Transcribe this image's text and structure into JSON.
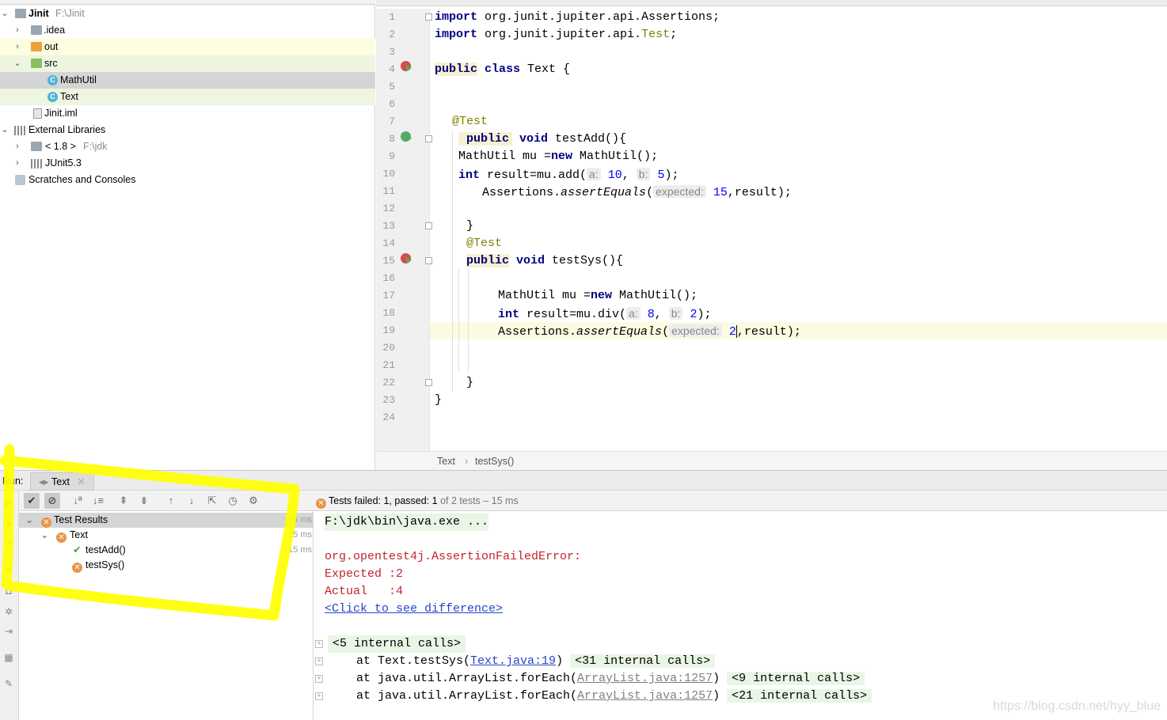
{
  "project_tree": {
    "root": {
      "name": "Jinit",
      "path": "F:\\Jinit"
    },
    "items": [
      {
        "label": "idea",
        "prefix": "."
      },
      {
        "label": "out"
      },
      {
        "label": "src"
      },
      {
        "label": "MathUtil"
      },
      {
        "label": "Text"
      },
      {
        "label": "Jinit.iml"
      },
      {
        "label": "External Libraries"
      },
      {
        "label": "< 1.8 >",
        "path": "F:\\jdk"
      },
      {
        "label": "JUnit5.3"
      },
      {
        "label": "Scratches and Consoles"
      }
    ]
  },
  "editor": {
    "line_numbers": [
      "1",
      "2",
      "3",
      "4",
      "5",
      "6",
      "7",
      "8",
      "9",
      "10",
      "11",
      "12",
      "13",
      "14",
      "15",
      "16",
      "17",
      "18",
      "19",
      "20",
      "21",
      "22",
      "23",
      "24"
    ],
    "code": {
      "l1_kw": "import",
      "l1_rest": " org.junit.jupiter.api.Assertions;",
      "l2_kw": "import",
      "l2_rest": " org.junit.jupiter.api.",
      "l2_ann": "Test",
      "l2_end": ";",
      "l4_kw1": "public",
      "l4_kw2": "class",
      "l4_rest": " Text {",
      "l7_ann": "@Test",
      "l8_kw1": "public",
      "l8_kw2": "void",
      "l8_rest": " testAdd(){",
      "l9_a": "MathUtil mu =",
      "l9_kw": "new",
      "l9_b": " MathUtil();",
      "l10_kw": "int",
      "l10_a": " result=mu.add(",
      "l10_h1": "a:",
      "l10_n1": "10",
      "l10_sep": ", ",
      "l10_h2": "b:",
      "l10_n2": "5",
      "l10_end": ");",
      "l11_a": "Assertions.",
      "l11_m": "assertEquals",
      "l11_p": "(",
      "l11_h": "expected:",
      "l11_n": "15",
      "l11_end": ",result);",
      "l13": "}",
      "l14_ann": "@Test",
      "l15_kw1": "public",
      "l15_kw2": "void",
      "l15_rest": " testSys(){",
      "l17_a": "MathUtil mu =",
      "l17_kw": "new",
      "l17_b": " MathUtil();",
      "l18_kw": "int",
      "l18_a": " result=mu.div(",
      "l18_h1": "a:",
      "l18_n1": "8",
      "l18_sep": ", ",
      "l18_h2": "b:",
      "l18_n2": "2",
      "l18_end": ");",
      "l19_a": "Assertions.",
      "l19_m": "assertEquals",
      "l19_p": "(",
      "l19_h": "expected:",
      "l19_n": "2",
      "l19_end": ",result);",
      "l22": "}",
      "l23": "}"
    },
    "breadcrumb": [
      "Text",
      "testSys()"
    ]
  },
  "run": {
    "label": "Run:",
    "tab": "Text",
    "status": {
      "failed_label": "Tests failed: 1, passed: 1",
      "rest": " of 2 tests – 15 ms"
    },
    "results": [
      {
        "label": "Test Results",
        "time": "15 ms"
      },
      {
        "label": "Text",
        "time": "15 ms"
      },
      {
        "label": "testAdd()",
        "time": "15 ms"
      },
      {
        "label": "testSys()",
        "time": ""
      }
    ]
  },
  "console": {
    "java_cmd": "F:\\jdk\\bin\\java.exe ...",
    "error": "org.opentest4j.AssertionFailedError:",
    "expected": "Expected :2",
    "actual": "Actual   :4",
    "diff_link": "<Click to see difference>",
    "internal5": "<5 internal calls>",
    "trace": [
      {
        "at": "at Text.testSys(",
        "link": "Text.java:19",
        "close": ")",
        "calls": "<31 internal calls>"
      },
      {
        "at": "at java.util.ArrayList.forEach(",
        "link": "ArrayList.java:1257",
        "close": ")",
        "calls": "<9 internal calls>"
      },
      {
        "at": "at java.util.ArrayList.forEach(",
        "link": "ArrayList.java:1257",
        "close": ")",
        "calls": "<21 internal calls>"
      }
    ]
  },
  "watermark": "https://blog.csdn.net/hyy_blue",
  "colors": {
    "annotation_highlight": "#ffff00",
    "failure": "#e8944a",
    "pass": "#4a9e4a"
  }
}
